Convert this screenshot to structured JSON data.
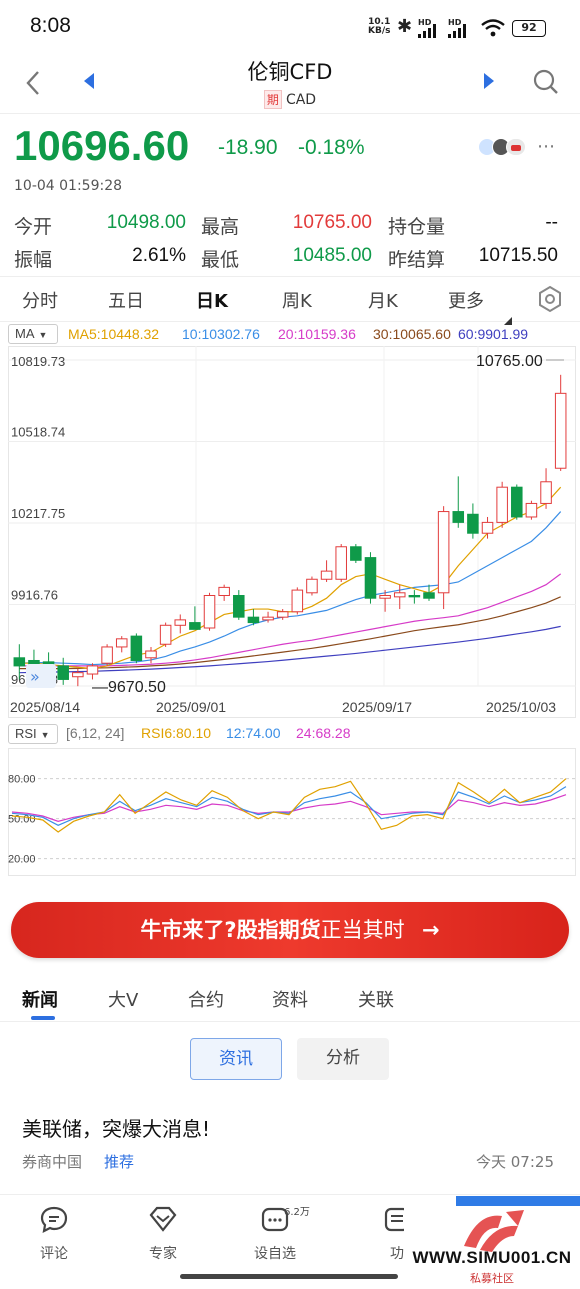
{
  "status_bar": {
    "time": "8:08",
    "net_speed": "10.1\nKB/s",
    "battery": "92",
    "hd1": "HD",
    "hd2": "HD"
  },
  "header": {
    "title": "伦铜CFD",
    "badge": "期",
    "currency": "CAD"
  },
  "quote": {
    "price": "10696.60",
    "change": "-18.90",
    "change_pct": "-0.18%",
    "timestamp": "10-04 01:59:28",
    "stats": [
      {
        "label": "今开",
        "value": "10498.00",
        "color": "green"
      },
      {
        "label": "最高",
        "value": "10765.00",
        "color": "red"
      },
      {
        "label": "持仓量",
        "value": "--",
        "color": "black"
      },
      {
        "label": "振幅",
        "value": "2.61%",
        "color": "black"
      },
      {
        "label": "最低",
        "value": "10485.00",
        "color": "green"
      },
      {
        "label": "昨结算",
        "value": "10715.50",
        "color": "black"
      }
    ]
  },
  "chart_tabs": [
    "分时",
    "五日",
    "日K",
    "周K",
    "月K",
    "更多"
  ],
  "active_chart_tab": "日K",
  "ma_legend": {
    "selector": "MA",
    "items": [
      {
        "text": "MA5:10448.32",
        "color": "#e0a100"
      },
      {
        "text": "10:10302.76",
        "color": "#3a8ee6"
      },
      {
        "text": "20:10159.36",
        "color": "#d63bc8"
      },
      {
        "text": "30:10065.60",
        "color": "#8a4a1c"
      },
      {
        "text": "60:9901.99",
        "color": "#3f3fbf"
      }
    ]
  },
  "rsi_legend": {
    "selector": "RSI",
    "params": "[6,12, 24]",
    "items": [
      {
        "text": "RSI6:80.10",
        "color": "#e0a100"
      },
      {
        "text": "12:74.00",
        "color": "#3a8ee6"
      },
      {
        "text": "24:68.28",
        "color": "#d63bc8"
      }
    ]
  },
  "chart_data": {
    "type": "candlestick",
    "y_ticks": [
      "10819.73",
      "10518.74",
      "10217.75",
      "9916.76",
      "9615.78"
    ],
    "ylim": [
      9615.78,
      10819.73
    ],
    "x_ticks": [
      "2025/08/14",
      "2025/09/01",
      "2025/09/17",
      "2025/10/03"
    ],
    "high_label": "10765.00",
    "low_label": "9670.50",
    "candles": [
      {
        "o": 9720,
        "h": 9770,
        "l": 9640,
        "c": 9690
      },
      {
        "o": 9710,
        "h": 9750,
        "l": 9660,
        "c": 9695
      },
      {
        "o": 9705,
        "h": 9740,
        "l": 9650,
        "c": 9680
      },
      {
        "o": 9690,
        "h": 9720,
        "l": 9620,
        "c": 9640
      },
      {
        "o": 9650,
        "h": 9680,
        "l": 9615,
        "c": 9665
      },
      {
        "o": 9660,
        "h": 9700,
        "l": 9640,
        "c": 9690
      },
      {
        "o": 9700,
        "h": 9770,
        "l": 9690,
        "c": 9760
      },
      {
        "o": 9760,
        "h": 9800,
        "l": 9740,
        "c": 9790
      },
      {
        "o": 9800,
        "h": 9810,
        "l": 9700,
        "c": 9710
      },
      {
        "o": 9720,
        "h": 9760,
        "l": 9700,
        "c": 9745
      },
      {
        "o": 9770,
        "h": 9850,
        "l": 9760,
        "c": 9840
      },
      {
        "o": 9840,
        "h": 9880,
        "l": 9810,
        "c": 9860
      },
      {
        "o": 9850,
        "h": 9910,
        "l": 9840,
        "c": 9825
      },
      {
        "o": 9830,
        "h": 9960,
        "l": 9820,
        "c": 9950
      },
      {
        "o": 9950,
        "h": 9990,
        "l": 9930,
        "c": 9980
      },
      {
        "o": 9950,
        "h": 9970,
        "l": 9860,
        "c": 9870
      },
      {
        "o": 9870,
        "h": 9900,
        "l": 9840,
        "c": 9850
      },
      {
        "o": 9860,
        "h": 9890,
        "l": 9850,
        "c": 9870
      },
      {
        "o": 9870,
        "h": 9900,
        "l": 9860,
        "c": 9890
      },
      {
        "o": 9890,
        "h": 9980,
        "l": 9880,
        "c": 9970
      },
      {
        "o": 9960,
        "h": 10020,
        "l": 9950,
        "c": 10010
      },
      {
        "o": 10010,
        "h": 10080,
        "l": 10000,
        "c": 10040
      },
      {
        "o": 10010,
        "h": 10140,
        "l": 10000,
        "c": 10130
      },
      {
        "o": 10130,
        "h": 10140,
        "l": 10070,
        "c": 10080
      },
      {
        "o": 10090,
        "h": 10110,
        "l": 9920,
        "c": 9940
      },
      {
        "o": 9940,
        "h": 9970,
        "l": 9890,
        "c": 9950
      },
      {
        "o": 9945,
        "h": 9990,
        "l": 9900,
        "c": 9960
      },
      {
        "o": 9950,
        "h": 9970,
        "l": 9920,
        "c": 9945
      },
      {
        "o": 9960,
        "h": 9990,
        "l": 9930,
        "c": 9940
      },
      {
        "o": 9960,
        "h": 10280,
        "l": 9900,
        "c": 10260
      },
      {
        "o": 10260,
        "h": 10390,
        "l": 10200,
        "c": 10220
      },
      {
        "o": 10250,
        "h": 10290,
        "l": 10160,
        "c": 10180
      },
      {
        "o": 10180,
        "h": 10240,
        "l": 10160,
        "c": 10220
      },
      {
        "o": 10220,
        "h": 10370,
        "l": 10200,
        "c": 10350
      },
      {
        "o": 10350,
        "h": 10360,
        "l": 10230,
        "c": 10240
      },
      {
        "o": 10240,
        "h": 10300,
        "l": 10230,
        "c": 10290
      },
      {
        "o": 10290,
        "h": 10420,
        "l": 10270,
        "c": 10370
      },
      {
        "o": 10420,
        "h": 10765,
        "l": 10410,
        "c": 10696.6
      }
    ],
    "ma5": [
      9700,
      9700,
      9695,
      9690,
      9685,
      9680,
      9690,
      9710,
      9730,
      9740,
      9770,
      9800,
      9820,
      9850,
      9880,
      9890,
      9900,
      9900,
      9890,
      9890,
      9910,
      9940,
      9990,
      10020,
      10030,
      10010,
      9990,
      9975,
      9960,
      9990,
      10060,
      10120,
      10180,
      10210,
      10240,
      10260,
      10290,
      10350
    ],
    "ma10": [
      9700,
      9702,
      9702,
      9700,
      9698,
      9695,
      9697,
      9700,
      9705,
      9712,
      9725,
      9745,
      9760,
      9778,
      9800,
      9825,
      9845,
      9860,
      9870,
      9875,
      9885,
      9895,
      9915,
      9935,
      9950,
      9960,
      9970,
      9980,
      9985,
      9990,
      10000,
      10030,
      10060,
      10090,
      10120,
      10150,
      10200,
      10260
    ],
    "ma20": [
      9690,
      9690,
      9690,
      9690,
      9690,
      9690,
      9690,
      9692,
      9694,
      9696,
      9700,
      9705,
      9712,
      9720,
      9730,
      9740,
      9750,
      9760,
      9770,
      9778,
      9785,
      9795,
      9805,
      9815,
      9825,
      9835,
      9845,
      9855,
      9862,
      9868,
      9875,
      9890,
      9905,
      9925,
      9945,
      9965,
      9990,
      10030
    ],
    "ma30": [
      9680,
      9680,
      9680,
      9680,
      9681,
      9682,
      9683,
      9685,
      9687,
      9690,
      9693,
      9697,
      9702,
      9708,
      9714,
      9720,
      9727,
      9734,
      9741,
      9748,
      9755,
      9763,
      9772,
      9781,
      9790,
      9800,
      9810,
      9820,
      9828,
      9835,
      9842,
      9852,
      9862,
      9875,
      9890,
      9905,
      9922,
      9945
    ],
    "ma60": [
      9665,
      9666,
      9667,
      9668,
      9669,
      9670,
      9672,
      9674,
      9676,
      9678,
      9681,
      9684,
      9687,
      9690,
      9694,
      9698,
      9702,
      9706,
      9711,
      9716,
      9721,
      9726,
      9731,
      9736,
      9742,
      9748,
      9754,
      9760,
      9766,
      9772,
      9778,
      9785,
      9792,
      9800,
      9808,
      9816,
      9825,
      9836
    ],
    "rsi": {
      "y_ticks": [
        "80.00",
        "50.00",
        "20.00"
      ],
      "ylim": [
        10,
        100
      ],
      "rsi6": [
        52,
        51,
        49,
        40,
        48,
        52,
        55,
        68,
        54,
        62,
        70,
        64,
        60,
        71,
        66,
        56,
        50,
        55,
        53,
        66,
        72,
        74,
        78,
        61,
        42,
        45,
        52,
        53,
        50,
        77,
        70,
        62,
        72,
        62,
        66,
        70,
        80
      ],
      "rsi12": [
        54,
        53,
        51,
        45,
        50,
        53,
        55,
        63,
        56,
        60,
        65,
        62,
        59,
        66,
        63,
        57,
        53,
        55,
        54,
        62,
        65,
        67,
        70,
        62,
        50,
        52,
        54,
        55,
        53,
        70,
        66,
        61,
        67,
        62,
        64,
        67,
        74
      ],
      "rsi24": [
        55,
        54,
        52,
        48,
        51,
        53,
        54,
        59,
        55,
        57,
        60,
        59,
        57,
        61,
        60,
        56,
        54,
        55,
        55,
        58,
        60,
        61,
        63,
        59,
        53,
        54,
        55,
        55,
        54,
        64,
        62,
        59,
        62,
        60,
        61,
        64,
        68
      ]
    }
  },
  "banner": {
    "pre": "牛市来了?",
    "bold": "股指期货",
    "post": "正当其时",
    "arrow": "→"
  },
  "news_tabs": [
    "新闻",
    "大V",
    "合约",
    "资料",
    "关联"
  ],
  "sub_tabs": [
    "资讯",
    "分析"
  ],
  "news": [
    {
      "title": "美联储，突爆大消息!",
      "source": "券商中国",
      "tag": "推荐",
      "time": "今天 07:25"
    }
  ],
  "bottom_nav": [
    {
      "label": "评论",
      "icon": "chat-icon"
    },
    {
      "label": "专家",
      "icon": "diamond-icon"
    },
    {
      "label": "设自选",
      "icon": "star-add-icon",
      "count": "6.2万"
    },
    {
      "label": "功",
      "icon": "function-icon"
    }
  ],
  "watermark": {
    "text": "WWW.SIMU001.CN",
    "sub": "私募社区"
  }
}
